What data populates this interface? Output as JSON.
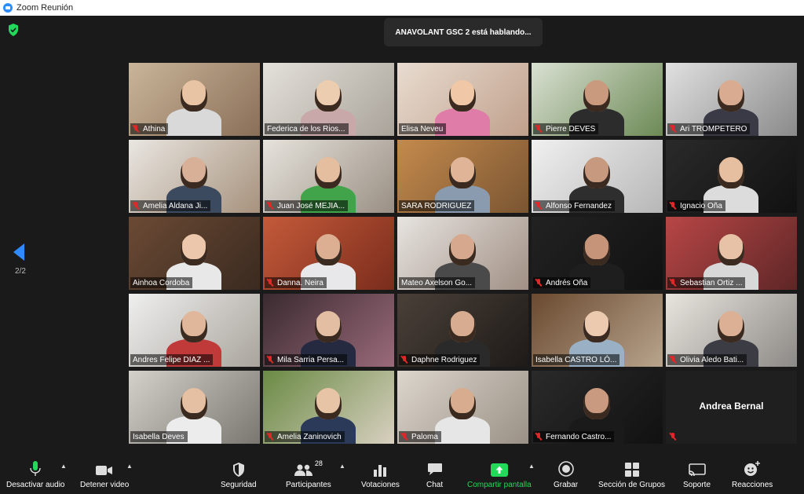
{
  "window": {
    "title": "Zoom Reunión"
  },
  "banner": {
    "speaking": "ANAVOLANT GSC 2 está hablando..."
  },
  "pager": {
    "indicator": "2/2"
  },
  "participants": [
    {
      "name": "Athina",
      "muted": true
    },
    {
      "name": "Federica de los Rios...",
      "muted": false
    },
    {
      "name": "Elisa Neveu",
      "muted": false
    },
    {
      "name": "Pierre DEVES",
      "muted": true
    },
    {
      "name": "Ari TROMPETERO",
      "muted": true
    },
    {
      "name": "Amelia Aldana Ji...",
      "muted": true
    },
    {
      "name": "Juan José MEJIA...",
      "muted": true
    },
    {
      "name": "SARA RODRIGUEZ",
      "muted": false
    },
    {
      "name": "Alfonso Fernandez",
      "muted": true
    },
    {
      "name": "Ignacio Oña",
      "muted": true
    },
    {
      "name": "Ainhoa Cordoba",
      "muted": false
    },
    {
      "name": "Danna.   Neira",
      "muted": true
    },
    {
      "name": "Mateo Axelson Go...",
      "muted": false
    },
    {
      "name": "Andrés Oña",
      "muted": true
    },
    {
      "name": "Sebastian Ortiz ...",
      "muted": true
    },
    {
      "name": "Andres Felipe DIAZ ...",
      "muted": false
    },
    {
      "name": "Mila Sarria Persa...",
      "muted": true
    },
    {
      "name": "Daphne Rodriguez",
      "muted": true
    },
    {
      "name": "Isabella CASTRO LÓ...",
      "muted": false
    },
    {
      "name": "Olivia Aledo Bati...",
      "muted": true
    },
    {
      "name": "Isabella Deves",
      "muted": false
    },
    {
      "name": "Amelia Zaninovich",
      "muted": true
    },
    {
      "name": "Paloma",
      "muted": true
    },
    {
      "name": "Fernando Castro...",
      "muted": true
    },
    {
      "name": "Andrea Bernal",
      "muted": true
    }
  ],
  "toolbar": {
    "audio": "Desactivar audio",
    "video": "Detener video",
    "security": "Seguridad",
    "participants": "Participantes",
    "participants_count": "28",
    "polls": "Votaciones",
    "chat": "Chat",
    "share": "Compartir pantalla",
    "record": "Grabar",
    "rooms": "Sección de Grupos",
    "support": "Soporte",
    "reactions": "Reacciones"
  },
  "colors": {
    "accent": "#2d8cff",
    "share_green": "#23d959",
    "muted_red": "#e02828"
  }
}
